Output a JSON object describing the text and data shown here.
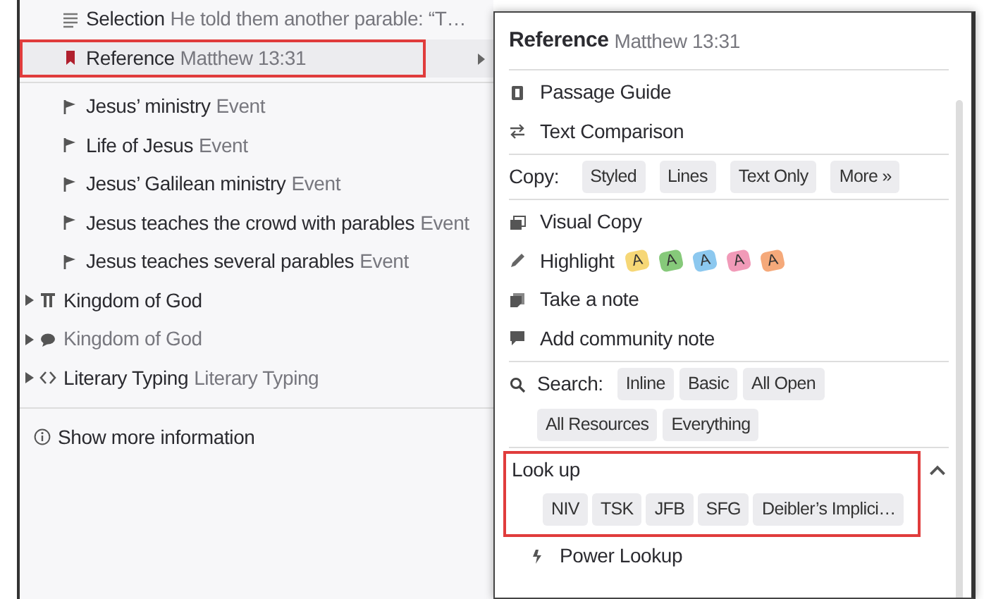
{
  "context_menu": {
    "items": [
      {
        "kind": "selection",
        "label": "Selection",
        "detail": "He told them another parable: “T…",
        "selected": false,
        "outlined": false
      },
      {
        "kind": "reference",
        "label": "Reference",
        "detail": "Matthew 13:31",
        "selected": true,
        "outlined": true
      },
      {
        "kind": "event",
        "label": "Jesus’ ministry",
        "detail": "Event",
        "selected": false,
        "outlined": false
      },
      {
        "kind": "event",
        "label": "Life of Jesus",
        "detail": "Event",
        "selected": false,
        "outlined": false
      },
      {
        "kind": "event",
        "label": "Jesus’ Galilean ministry",
        "detail": "Event",
        "selected": false,
        "outlined": false
      },
      {
        "kind": "event",
        "label": "Jesus teaches the crowd with parables",
        "detail": "Event",
        "selected": false,
        "outlined": false
      },
      {
        "kind": "event",
        "label": "Jesus teaches several parables",
        "detail": "Event",
        "selected": false,
        "outlined": false
      },
      {
        "kind": "topic",
        "label": "Kingdom of God",
        "expanded": false,
        "muted": false
      },
      {
        "kind": "sermon",
        "label": "Kingdom of God",
        "expanded": false,
        "muted": true
      },
      {
        "kind": "typing",
        "label": "Literary Typing",
        "detail": "Literary Typing",
        "expanded": false,
        "muted": false
      }
    ],
    "footer": "Show more information"
  },
  "submenu": {
    "title": "Reference",
    "detail": "Matthew 13:31",
    "sections": [
      {
        "kind": "actions",
        "items": [
          {
            "label": "Passage Guide"
          },
          {
            "label": "Text Comparison"
          }
        ]
      },
      {
        "kind": "chips",
        "label": "Copy:",
        "buttons": [
          "Styled",
          "Lines",
          "Text Only",
          "More »"
        ]
      },
      {
        "kind": "actions",
        "items": [
          {
            "label": "Visual Copy"
          },
          {
            "label": "Highlight",
            "swatches": [
              {
                "label": "A",
                "color": "#f6d776"
              },
              {
                "label": "A",
                "color": "#86c97a"
              },
              {
                "label": "A",
                "color": "#8cc8ef"
              },
              {
                "label": "A",
                "color": "#f19ab8"
              },
              {
                "label": "A",
                "color": "#f5a97a"
              }
            ]
          },
          {
            "label": "Take a note"
          },
          {
            "label": "Add community note"
          }
        ]
      },
      {
        "kind": "chips",
        "label": "Search:",
        "buttons": [
          "Inline",
          "Basic",
          "All Open",
          "All Resources",
          "Everything"
        ]
      },
      {
        "kind": "lookup",
        "label": "Look up",
        "expanded": true,
        "outlined": true,
        "buttons": [
          "NIV",
          "TSK",
          "JFB",
          "SFG",
          "Deibler’s Implici…"
        ]
      },
      {
        "kind": "actions",
        "items": [
          {
            "label": "Power Lookup"
          }
        ]
      }
    ]
  }
}
